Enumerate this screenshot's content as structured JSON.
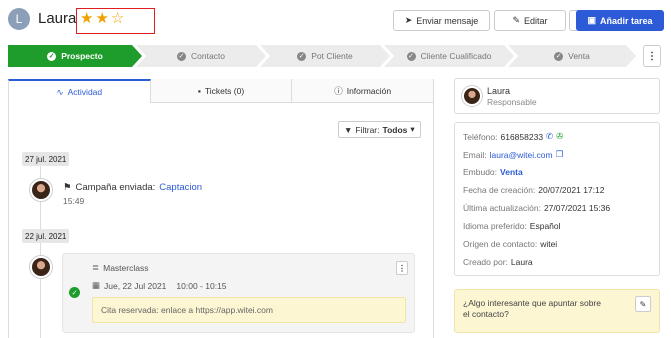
{
  "contact": {
    "initial": "L",
    "name": "Laura",
    "stars": "★★☆"
  },
  "toolbar": {
    "send_label": "Enviar mensaje",
    "edit_label": "Editar",
    "add_task_label": "Añadir tarea"
  },
  "pipeline": {
    "stages": [
      "Prospecto",
      "Contacto",
      "Pot Cliente",
      "Cliente Cualificado",
      "Venta"
    ]
  },
  "tabs": {
    "activity": "Actividad",
    "tickets": "Tickets (0)",
    "info": "Información"
  },
  "filter": {
    "label": "Filtrar:",
    "value": "Todos"
  },
  "timeline": {
    "date1": "27 jul. 2021",
    "event1_prefix": "Campaña enviada:",
    "event1_link": "Captacion",
    "event1_time": "15:49",
    "date2": "22 jul. 2021",
    "card_title": "Masterclass",
    "card_date": "Jue, 22 Jul 2021",
    "card_time": "10:00 - 10:15",
    "card_note": "Cita reservada: enlace a https://app.witei.com"
  },
  "responsible": {
    "name": "Laura",
    "role": "Responsable"
  },
  "info": {
    "phone_label": "Teléfono:",
    "phone": "616858233",
    "email_label": "Email:",
    "email": "laura@witei.com",
    "funnel_label": "Embudo:",
    "funnel": "Venta",
    "created_label": "Fecha de creación:",
    "created": "20/07/2021 17:12",
    "updated_label": "Última actualización:",
    "updated": "27/07/2021 15:36",
    "lang_label": "Idioma preferido:",
    "lang": "Español",
    "origin_label": "Origen de contacto:",
    "origin": "witei",
    "creator_label": "Creado por:",
    "creator": "Laura"
  },
  "notes": {
    "prompt": "¿Algo interesante que apuntar sobre el contacto?"
  },
  "colors": {
    "accent": "#2d5bd8",
    "stage_active": "#1f9d2c",
    "highlight_box": "#e02020"
  }
}
